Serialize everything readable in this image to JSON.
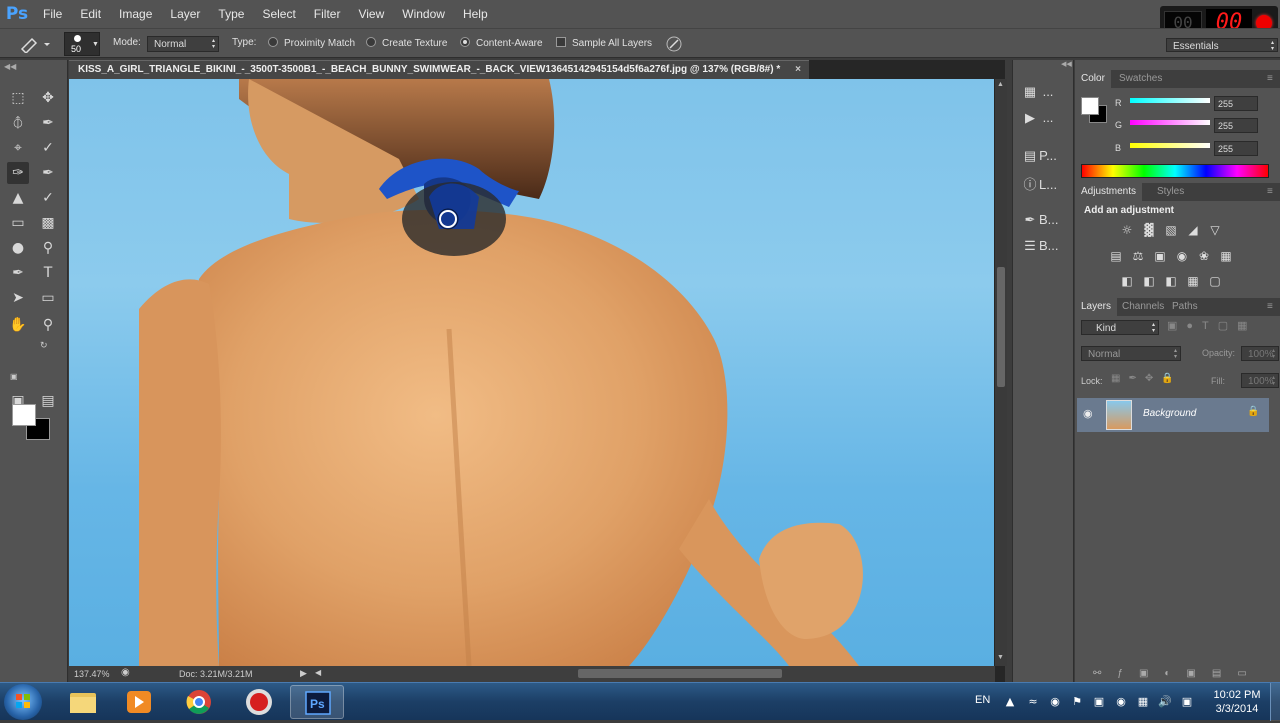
{
  "app": {
    "logo": "Ps"
  },
  "menu": [
    "File",
    "Edit",
    "Image",
    "Layer",
    "Type",
    "Select",
    "Filter",
    "View",
    "Window",
    "Help"
  ],
  "recorder": {
    "left_digits": "00",
    "right_digits": "00"
  },
  "options": {
    "brush_size": "50",
    "mode_label": "Mode:",
    "mode_value": "Normal",
    "type_label": "Type:",
    "type_options": [
      "Proximity Match",
      "Create Texture",
      "Content-Aware"
    ],
    "selected_type": "Content-Aware",
    "sample_all_layers": "Sample All Layers",
    "sample_all_layers_checked": false
  },
  "workspace": "Essentials",
  "document": {
    "tab_title": "KISS_A_GIRL_TRIANGLE_BIKINI_-_3500T-3500B1_-_BEACH_BUNNY_SWIMWEAR_-_BACK_VIEW13645142945154d5f6a276f.jpg @ 137% (RGB/8#) *",
    "close": "×",
    "zoom": "137.47%",
    "doc_size": "Doc: 3.21M/3.21M"
  },
  "mini_panels": [
    {
      "icon": "history-icon",
      "label": "..."
    },
    {
      "icon": "actions-icon",
      "label": "..."
    },
    {
      "icon": "paragraph-icon",
      "label": "P..."
    },
    {
      "icon": "info-icon",
      "label": "L..."
    },
    {
      "icon": "brush-icon",
      "label": "B..."
    },
    {
      "icon": "brush-presets-icon",
      "label": "B..."
    }
  ],
  "color_panel": {
    "tabs": [
      "Color",
      "Swatches"
    ],
    "channels": [
      {
        "name": "R",
        "value": "255",
        "color": "#4de8e8"
      },
      {
        "name": "G",
        "value": "255",
        "color": "#e84de8"
      },
      {
        "name": "B",
        "value": "255",
        "color": "#e8e84d"
      }
    ]
  },
  "adjustments_panel": {
    "tabs": [
      "Adjustments",
      "Styles"
    ],
    "heading": "Add an adjustment"
  },
  "layers_panel": {
    "tabs": [
      "Layers",
      "Channels",
      "Paths"
    ],
    "kind": "Kind",
    "blend_mode": "Normal",
    "opacity_label": "Opacity:",
    "opacity_value": "100%",
    "lock_label": "Lock:",
    "fill_label": "Fill:",
    "fill_value": "100%",
    "layer_name": "Background"
  },
  "taskbar": {
    "lang": "EN",
    "time": "10:02 PM",
    "date": "3/3/2014"
  },
  "colors": {
    "accent": "#4aa3ff",
    "canvas_sky": "#7fc3ea",
    "skin": "#e0a167",
    "bikini_strap": "#1e54c8"
  }
}
